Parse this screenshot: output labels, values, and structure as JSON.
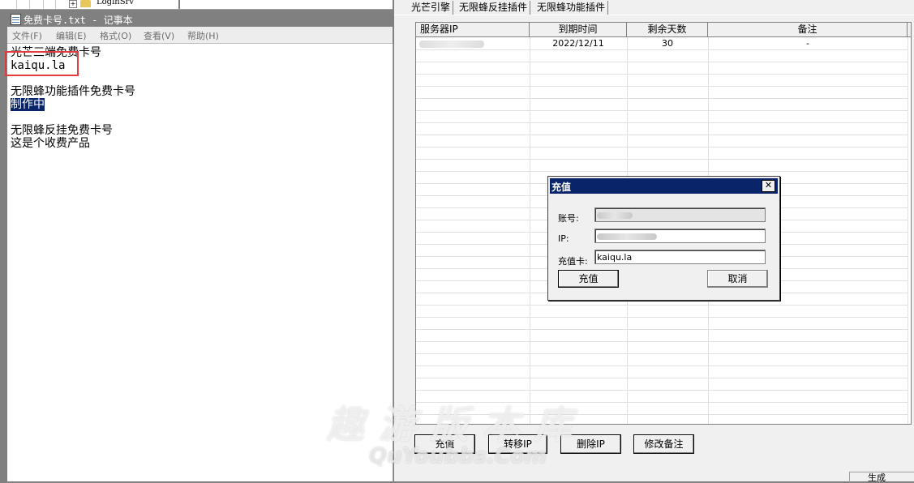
{
  "tree": {
    "node_label": "LoginSrv"
  },
  "notepad": {
    "title": "免费卡号.txt - 记事本",
    "menu": [
      "文件(F)",
      "编辑(E)",
      "格式(O)",
      "查看(V)",
      "帮助(H)"
    ],
    "lines": [
      "光芒三端免费卡号",
      "kaiqu.la",
      "",
      "无限蜂功能插件免费卡号",
      "制作中",
      "",
      "无限蜂反挂免费卡号",
      "这是个收费产品"
    ]
  },
  "tabs": [
    "光芒引擎",
    "无限蜂反挂插件",
    "无限蜂功能插件"
  ],
  "grid": {
    "columns": [
      "服务器IP",
      "到期时间",
      "剩余天数",
      "备注"
    ],
    "rows": [
      {
        "ip": "",
        "expiry": "2022/12/11",
        "days": "30",
        "note": "-"
      }
    ]
  },
  "buttons": {
    "recharge": "充值",
    "transfer_ip": "转移IP",
    "delete_ip": "删除IP",
    "edit_note": "修改备注"
  },
  "partial_label": "生成",
  "dialog": {
    "title": "充值",
    "account_label": "账号:",
    "ip_label": "IP:",
    "card_label": "充值卡:",
    "card_value": "kaiqu.la",
    "confirm": "充值",
    "cancel": "取消"
  },
  "watermark": {
    "cn": "趣游版本库",
    "en": "QuYoubbs.Com"
  }
}
